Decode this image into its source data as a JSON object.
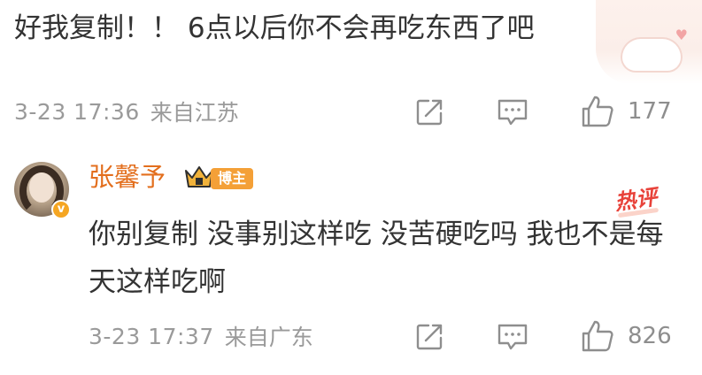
{
  "top_comment": {
    "text": "好我复制！！ 6点以后你不会再吃东西了吧",
    "time": "3-23 17:36",
    "location": "来自江苏",
    "like_count": "177"
  },
  "reply": {
    "username": "张馨予",
    "badge": "博主",
    "hot_label": "热评",
    "text": "你别复制 没事别这样吃 没苦硬吃吗 我也不是每天这样吃啊",
    "time": "3-23 17:37",
    "location": "来自广东",
    "like_count": "826"
  },
  "icons": {
    "share": "share-icon",
    "comment": "comment-icon",
    "like": "thumbs-up-icon",
    "crown": "crown-icon",
    "verified": "verified-v-icon"
  },
  "colors": {
    "username": "#e36f1e",
    "badge": "#f4a037",
    "hot": "#e8423a",
    "meta": "#9a9a9a"
  }
}
